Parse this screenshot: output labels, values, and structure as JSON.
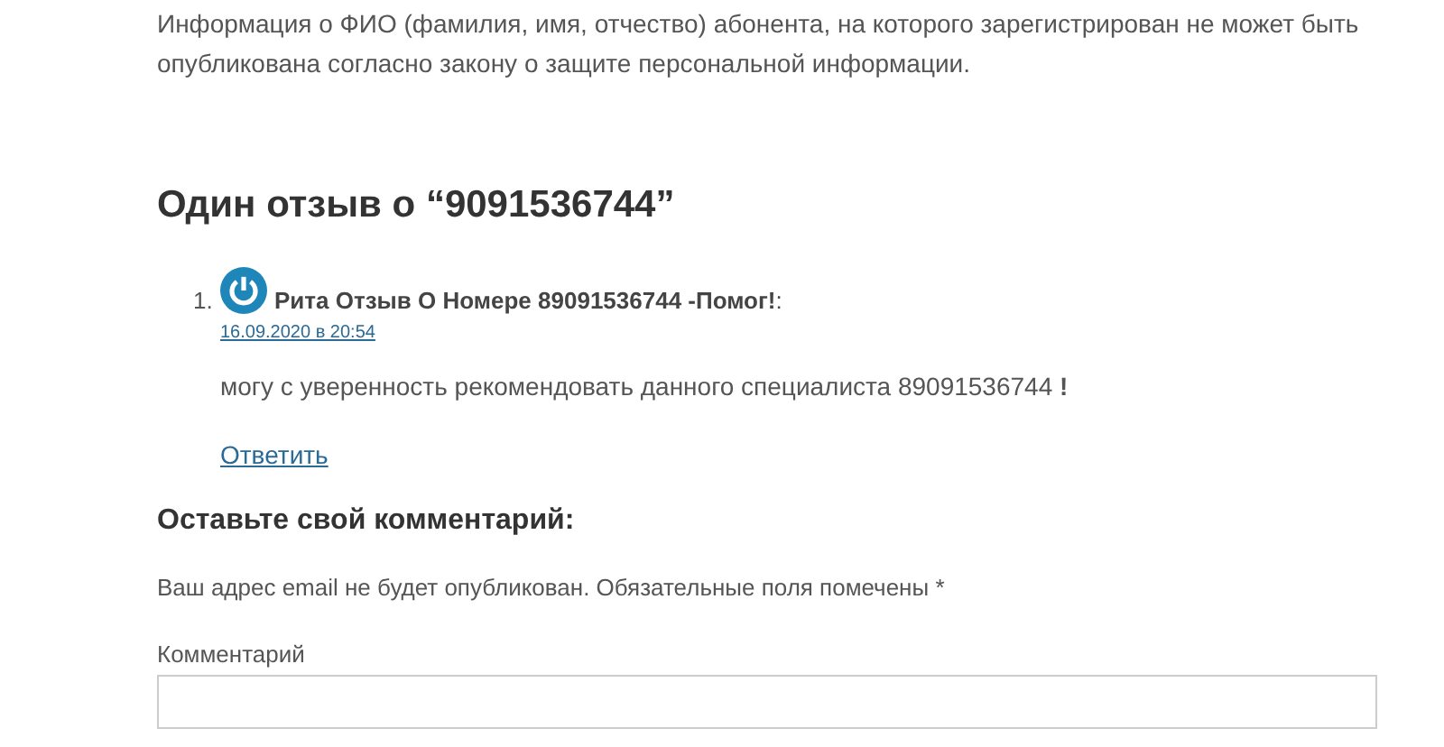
{
  "intro": "Информация о ФИО (фамилия, имя, отчество) абонента, на которого зарегистрирован не может быть опубликована согласно закону о защите персональной информации.",
  "comments_title": "Один отзыв о “9091536744”",
  "comments": [
    {
      "number": "1.",
      "author": "**Рита Отзыв О Номере 89091536744 -Помог!**:",
      "date": "16.09.2020 в 20:54",
      "text": "могу с уверенность рекомендовать данного специалиста 89091536744 **!**",
      "reply": "Ответить"
    }
  ],
  "form": {
    "title": "Оставьте свой комментарий:",
    "note": "Ваш адрес email не будет опубликован. Обязательные поля помечены *",
    "comment_label": "Комментарий"
  }
}
